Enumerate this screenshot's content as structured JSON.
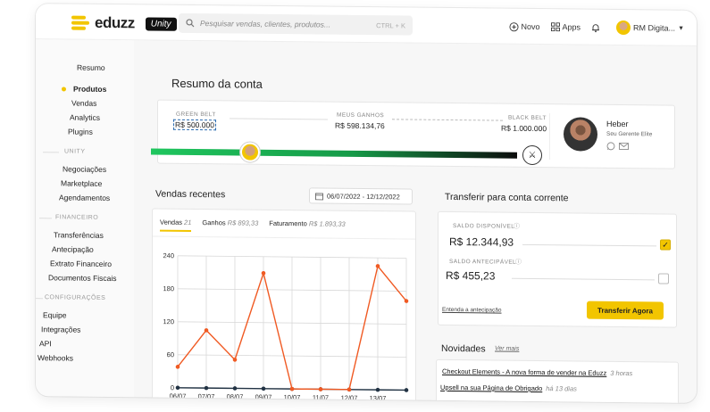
{
  "brand": {
    "name": "eduzz",
    "badge": "Unity"
  },
  "search": {
    "placeholder": "Pesquisar vendas, clientes, produtos...",
    "shortcut": "CTRL + K"
  },
  "top_actions": {
    "new_label": "Novo",
    "apps_label": "Apps",
    "user_name": "RM Digita..."
  },
  "sidebar": {
    "resumo": "Resumo",
    "produtos": "Produtos",
    "vendas": "Vendas",
    "analytics": "Analytics",
    "plugins": "Plugins",
    "unity_section": "UNITY",
    "negociacoes": "Negociações",
    "marketplace": "Marketplace",
    "agendamentos": "Agendamentos",
    "financeiro_section": "FINANCEIRO",
    "transferencias": "Transferências",
    "antecipacao": "Antecipação",
    "extrato": "Extrato Financeiro",
    "documentos": "Documentos Fiscais",
    "config_section": "CONFIGURAÇÕES",
    "equipe": "Equipe",
    "integracoes": "Integrações",
    "api": "API",
    "webhooks": "Webhooks"
  },
  "resumo": {
    "title": "Resumo da conta",
    "green_belt_label": "GREEN BELT",
    "green_belt_value": "R$ 500.000",
    "earnings_label": "MEUS GANHOS",
    "earnings_value": "R$ 598.134,76",
    "black_belt_label": "BLACK BELT",
    "black_belt_value": "R$ 1.000.000",
    "manager_name": "Heber",
    "manager_role": "Seu Gerente Elite"
  },
  "vendas": {
    "title": "Vendas recentes",
    "date_range": "06/07/2022 - 12/12/2022",
    "tabs": [
      {
        "label": "Vendas",
        "count": "21"
      },
      {
        "label": "Ganhos",
        "count": "R$ 893,33"
      },
      {
        "label": "Faturamento",
        "count": "R$ 1.893,33"
      }
    ]
  },
  "chart_data": {
    "type": "line",
    "x": [
      "06/07",
      "07/07",
      "08/07",
      "09/07",
      "10/07",
      "11/07",
      "12/07",
      "13/07",
      "14/07"
    ],
    "series": [
      {
        "values": [
          38,
          105,
          52,
          210,
          0,
          0,
          0,
          225,
          162
        ],
        "color": "#f05a23"
      },
      {
        "values": [
          0,
          0,
          0,
          0,
          0,
          0,
          0,
          0,
          0
        ],
        "color": "#223344"
      }
    ],
    "y_ticks": [
      0,
      60,
      120,
      180,
      240
    ],
    "x_ticks": [
      "06/07",
      "07/07",
      "08/07",
      "09/07",
      "10/07",
      "11/07",
      "12/07",
      "13/07"
    ],
    "ylim": [
      0,
      240
    ],
    "grid": true
  },
  "transfer": {
    "title": "Transferir para conta corrente",
    "available_label": "SALDO DISPONÍVEL",
    "available_value": "R$ 12.344,93",
    "anticipable_label": "SALDO ANTECIPÁVEL",
    "anticipable_value": "R$ 455,23",
    "link": "Entenda a antecipação",
    "button": "Transferir Agora"
  },
  "novidades": {
    "title": "Novidades",
    "see_more": "Ver mais",
    "items": [
      {
        "text": "Checkout Elements - A nova forma de vender na Eduzz",
        "when": "3 horas"
      },
      {
        "text": "Upsell na sua Página de Obrigado",
        "when": "há 13 dias"
      }
    ]
  },
  "colors": {
    "accent": "#f2c500",
    "line": "#f05a23",
    "progress_start": "#1fc65e",
    "progress_end": "#0c0c0c"
  }
}
